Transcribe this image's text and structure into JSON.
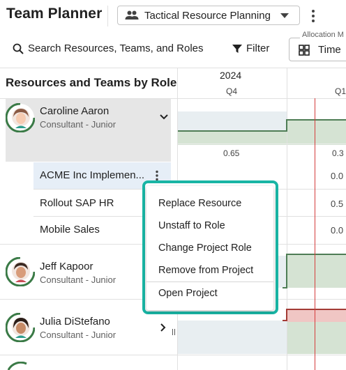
{
  "header": {
    "title": "Team Planner",
    "plan_select": "Tactical Resource Planning"
  },
  "toolbar": {
    "search": "Search Resources, Teams, and Roles",
    "filter": "Filter",
    "allocation_legend": "Allocation M",
    "time": "Time"
  },
  "grid": {
    "left_header": "Resources and Teams by Role",
    "year": "2024",
    "quarters": [
      "Q4",
      "Q1"
    ]
  },
  "resources": [
    {
      "name": "Caroline Aaron",
      "role": "Consultant - Junior",
      "allocation": [
        "0.65",
        "0.3"
      ],
      "projects": [
        {
          "name": "ACME Inc Implemen...",
          "value": "0.0"
        },
        {
          "name": "Rollout SAP HR",
          "value": "0.5"
        },
        {
          "name": "Mobile Sales",
          "value": "0.0"
        }
      ]
    },
    {
      "name": "Jeff Kapoor",
      "role": "Consultant - Junior"
    },
    {
      "name": "Julia DiStefano",
      "role": "Consultant - Junior"
    }
  ],
  "context_menu": {
    "items": [
      "Replace Resource",
      "Unstaff to Role",
      "Change Project Role",
      "Remove from Project"
    ],
    "open_project": "Open Project"
  },
  "colors": {
    "accent": "#19b5a5",
    "alloc_fill": "#d5e3d3",
    "alloc_line": "#4e7d55",
    "over_fill": "#f0c6c4",
    "over_line": "#a33b35",
    "today": "#d43c3c"
  },
  "icons": [
    "people-icon",
    "dropdown-arrow-icon",
    "more-vert-icon",
    "search-icon",
    "filter-icon",
    "grid-view-icon",
    "chevron-down-icon",
    "chevron-right-icon"
  ]
}
